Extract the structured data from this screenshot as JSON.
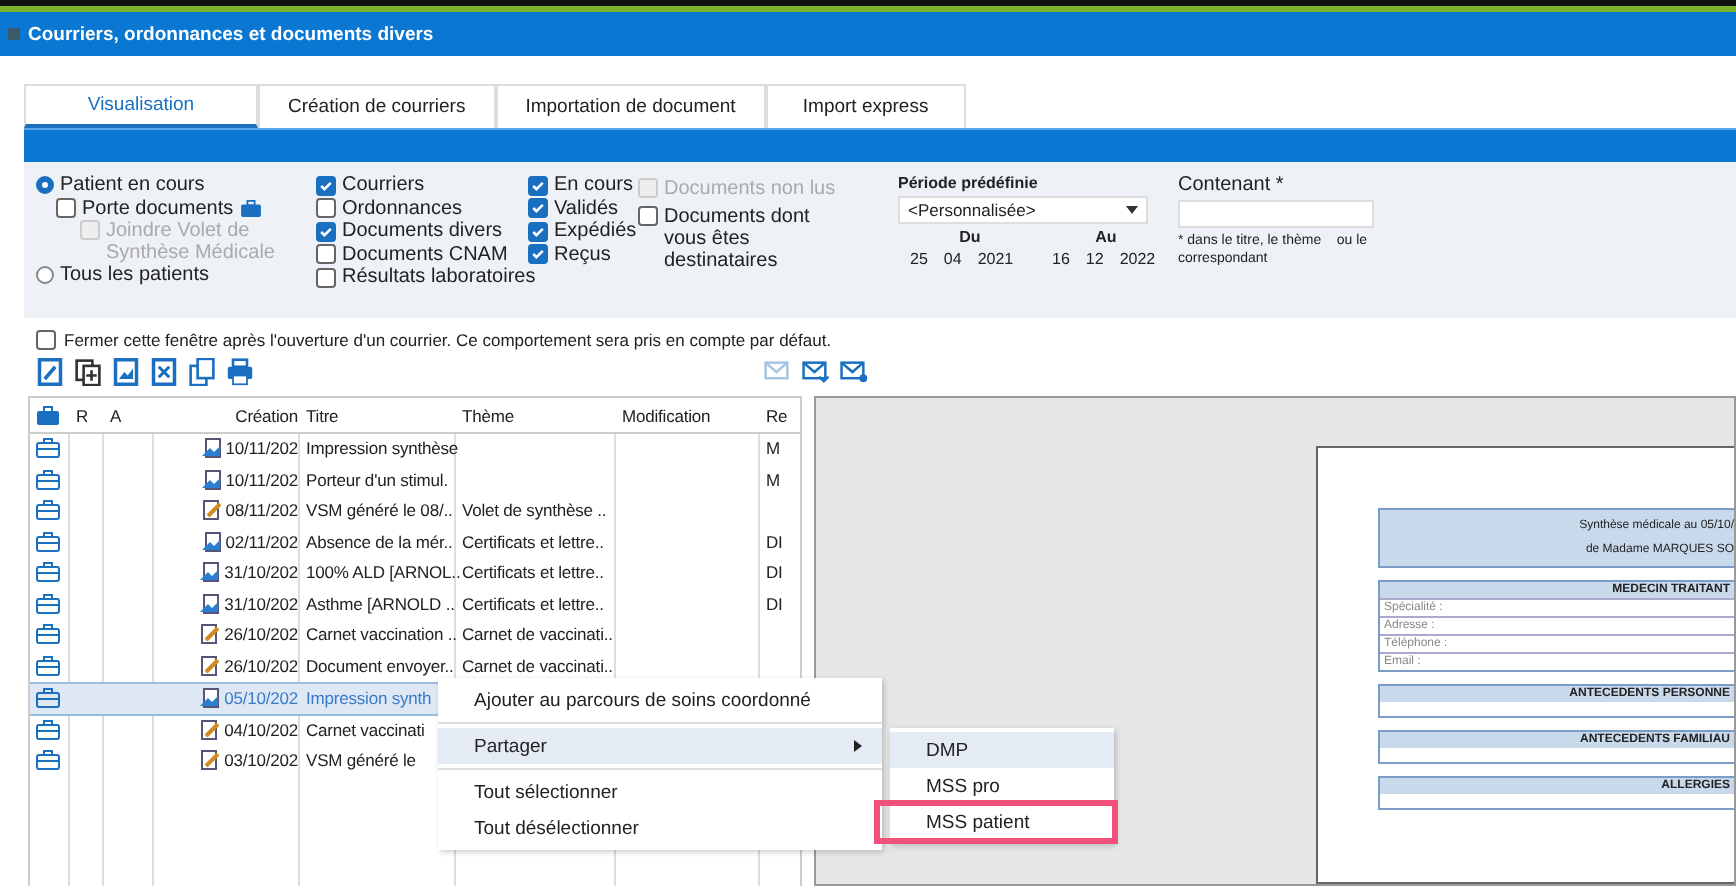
{
  "window": {
    "title": "Courriers, ordonnances et documents divers"
  },
  "tabs": [
    {
      "label": "Visualisation",
      "selected": true
    },
    {
      "label": "Création de courriers",
      "selected": false
    },
    {
      "label": "Importation de document",
      "selected": false
    },
    {
      "label": "Import express",
      "selected": false
    }
  ],
  "patient": {
    "options": [
      {
        "label": "Patient en cours",
        "selected": true
      },
      {
        "label": "Tous les patients",
        "selected": false
      }
    ],
    "porte_documents": {
      "label": "Porte documents",
      "checked": false
    },
    "joindre": {
      "label": "Joindre Volet de Synthèse Médicale",
      "checked": false,
      "disabled": true
    }
  },
  "types": [
    {
      "label": "Courriers",
      "checked": true
    },
    {
      "label": "Ordonnances",
      "checked": false
    },
    {
      "label": "Documents divers",
      "checked": true
    },
    {
      "label": "Documents CNAM",
      "checked": false
    },
    {
      "label": "Résultats laboratoires",
      "checked": false
    }
  ],
  "statuses": [
    {
      "label": "En cours",
      "checked": true
    },
    {
      "label": "Validés",
      "checked": true
    },
    {
      "label": "Expédiés",
      "checked": true
    },
    {
      "label": "Reçus",
      "checked": true
    }
  ],
  "reading": [
    {
      "label": "Documents non lus",
      "checked": false,
      "disabled": true
    },
    {
      "label": "Documents dont vous êtes destinataires",
      "checked": false,
      "disabled": false
    }
  ],
  "period": {
    "label": "Période prédéfinie",
    "value": "<Personnalisée>",
    "from_label": "Du",
    "to_label": "Au",
    "from": [
      "25",
      "04",
      "2021"
    ],
    "to": [
      "16",
      "12",
      "2022"
    ]
  },
  "contenant": {
    "label": "Contenant *",
    "hint": "* dans le titre, le thème    ou le correspondant"
  },
  "close_option": {
    "label": "Fermer cette fenêtre après l'ouverture d'un courrier. Ce comportement sera pris en compte par défaut.",
    "checked": false
  },
  "toolbar": [
    {
      "kind": "edit"
    },
    {
      "kind": "copy-add"
    },
    {
      "kind": "image"
    },
    {
      "kind": "delete"
    },
    {
      "kind": "duplicate"
    },
    {
      "kind": "print"
    }
  ],
  "mail_toolbar": [
    {
      "kind": "mail-disabled"
    },
    {
      "kind": "mail-reply"
    },
    {
      "kind": "mail-send"
    }
  ],
  "table": {
    "columns": [
      "R",
      "A",
      "Création",
      "Titre",
      "Thème",
      "Modification",
      "Re"
    ],
    "rows": [
      {
        "kind": "scan",
        "selected": false,
        "cells": [
          "",
          "",
          "10/11/202",
          "Impression synthèse",
          "",
          "",
          "M"
        ]
      },
      {
        "kind": "scan",
        "selected": false,
        "cells": [
          "",
          "",
          "10/11/202",
          "Porteur d'un stimul.",
          "",
          "",
          "M"
        ]
      },
      {
        "kind": "edit",
        "selected": false,
        "cells": [
          "",
          "",
          "08/11/202",
          "VSM généré le 08/..",
          "Volet de synthèse ..",
          "",
          ""
        ]
      },
      {
        "kind": "scan",
        "selected": false,
        "cells": [
          "",
          "",
          "02/11/202",
          "Absence de la mér..",
          "Certificats et lettre..",
          "",
          "DI"
        ]
      },
      {
        "kind": "scan",
        "selected": false,
        "cells": [
          "",
          "",
          "31/10/202",
          "100% ALD [ARNOL..",
          "Certificats et lettre..",
          "",
          "DI"
        ]
      },
      {
        "kind": "scan",
        "selected": false,
        "cells": [
          "",
          "",
          "31/10/202",
          "Asthme [ARNOLD ..",
          "Certificats et lettre..",
          "",
          "DI"
        ]
      },
      {
        "kind": "edit",
        "selected": false,
        "cells": [
          "",
          "",
          "26/10/202",
          "Carnet vaccination ..",
          "Carnet de vaccinati..",
          "",
          ""
        ]
      },
      {
        "kind": "edit",
        "selected": false,
        "cells": [
          "",
          "",
          "26/10/202",
          "Document envoyer..",
          "Carnet de vaccinati..",
          "",
          ""
        ]
      },
      {
        "kind": "scan",
        "selected": true,
        "cells": [
          "",
          "",
          "05/10/202",
          "Impression synth",
          "",
          "",
          ""
        ]
      },
      {
        "kind": "edit",
        "selected": false,
        "cells": [
          "",
          "",
          "04/10/202",
          "Carnet vaccinati",
          "",
          "",
          ""
        ]
      },
      {
        "kind": "edit",
        "selected": false,
        "cells": [
          "",
          "",
          "03/10/202",
          "VSM généré le",
          "",
          "",
          ""
        ]
      }
    ]
  },
  "context_menu": [
    {
      "kind": "item",
      "label": "Ajouter au parcours de soins coordonné",
      "highlighted": false,
      "submenu": false
    },
    {
      "kind": "separator"
    },
    {
      "kind": "item",
      "label": "Partager",
      "highlighted": true,
      "submenu": true
    },
    {
      "kind": "separator"
    },
    {
      "kind": "item",
      "label": "Tout sélectionner",
      "highlighted": false,
      "submenu": false
    },
    {
      "kind": "item",
      "label": "Tout désélectionner",
      "highlighted": false,
      "submenu": false
    }
  ],
  "submenu": [
    {
      "label": "DMP",
      "highlighted": true,
      "outlined": false
    },
    {
      "label": "MSS pro",
      "highlighted": false,
      "outlined": false
    },
    {
      "label": "MSS patient",
      "highlighted": false,
      "outlined": true
    }
  ],
  "document": {
    "title_lines": [
      "Synthèse médicale au 05/10/",
      "de Madame MARQUES SO"
    ],
    "sections": [
      {
        "heading": "MEDECIN TRAITANT",
        "fields": [
          "Spécialité :",
          "Adresse :",
          "Téléphone :",
          "Email :"
        ]
      },
      {
        "heading": "ANTECEDENTS PERSONNE"
      },
      {
        "heading": "ANTECEDENTS FAMILIAU"
      },
      {
        "heading": "ALLERGIES"
      }
    ]
  }
}
